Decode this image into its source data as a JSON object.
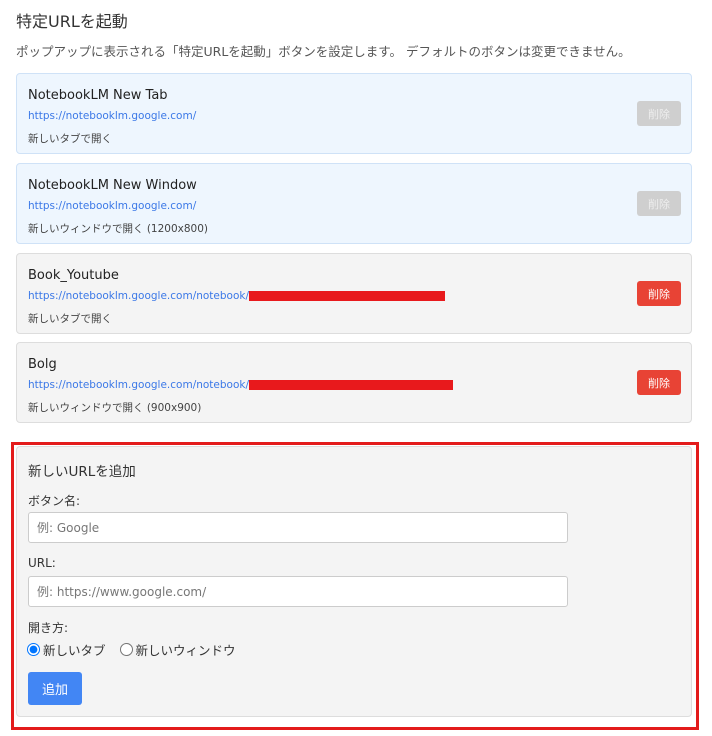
{
  "title": "特定URLを起動",
  "description": "ポップアップに表示される「特定URLを起動」ボタンを設定します。 デフォルトのボタンは変更できません。",
  "items": [
    {
      "name": "NotebookLM New Tab",
      "url": "https://notebooklm.google.com/",
      "mode": "新しいタブで開く",
      "delete": "削除",
      "default": true
    },
    {
      "name": "NotebookLM New Window",
      "url": "https://notebooklm.google.com/",
      "mode": "新しいウィンドウで開く (1200x800)",
      "delete": "削除",
      "default": true
    },
    {
      "name": "Book_Youtube",
      "url": "https://notebooklm.google.com/notebook/",
      "mode": "新しいタブで開く",
      "delete": "削除",
      "default": false
    },
    {
      "name": "Bolg",
      "url": "https://notebooklm.google.com/notebook/",
      "mode": "新しいウィンドウで開く (900x900)",
      "delete": "削除",
      "default": false
    }
  ],
  "form": {
    "title": "新しいURLを追加",
    "name_label": "ボタン名:",
    "name_placeholder": "例: Google",
    "url_label": "URL:",
    "url_placeholder": "例: https://www.google.com/",
    "mode_label": "開き方:",
    "option_tab": "新しいタブ",
    "option_window": "新しいウィンドウ",
    "add_label": "追加"
  },
  "colors": {
    "accent": "#4286f4",
    "danger": "#e84335",
    "highlight": "#e31b1b"
  }
}
